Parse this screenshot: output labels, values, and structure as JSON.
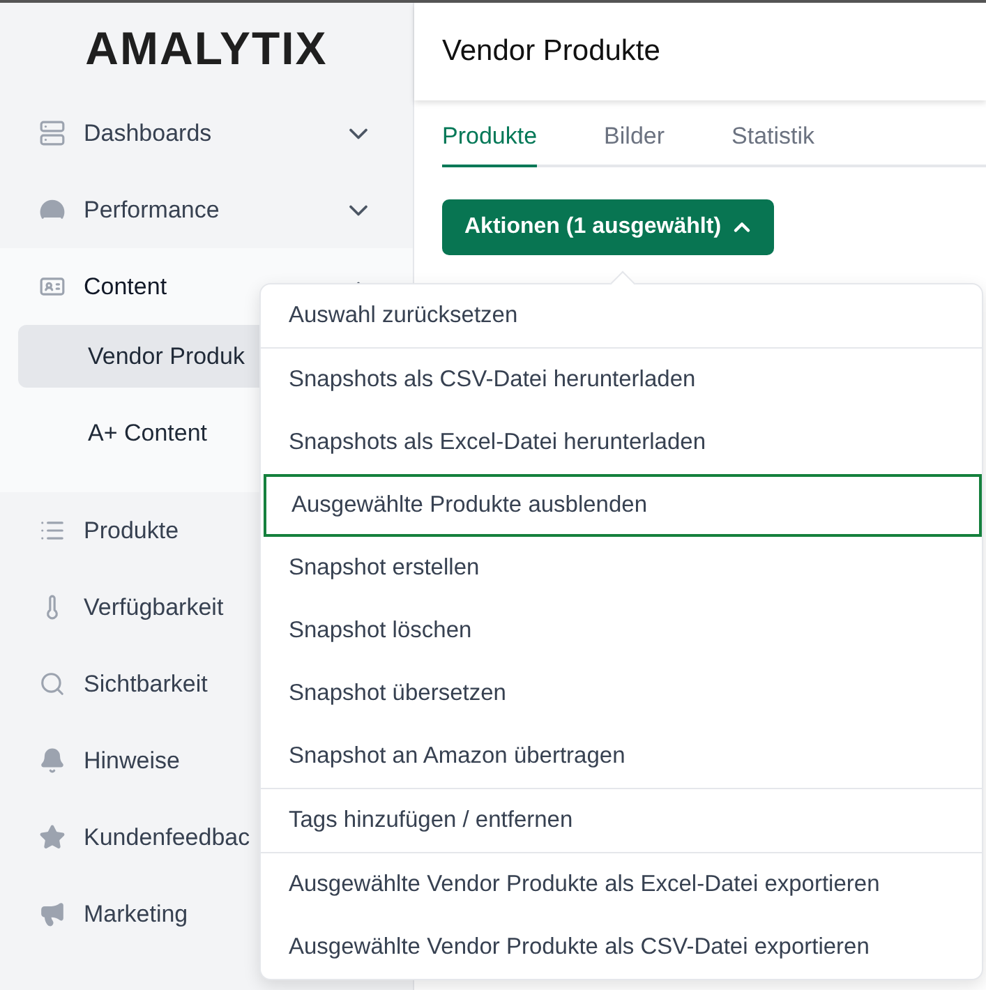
{
  "logo": "AMALYTIX",
  "sidebar": {
    "items": [
      {
        "label": "Dashboards",
        "expanded": false
      },
      {
        "label": "Performance",
        "expanded": false
      },
      {
        "label": "Content",
        "expanded": true,
        "children": [
          {
            "label": "Vendor Produk",
            "selected": true
          },
          {
            "label": "A+ Content",
            "selected": false
          }
        ]
      },
      {
        "label": "Produkte"
      },
      {
        "label": "Verfügbarkeit"
      },
      {
        "label": "Sichtbarkeit"
      },
      {
        "label": "Hinweise"
      },
      {
        "label": "Kundenfeedbac"
      },
      {
        "label": "Marketing"
      }
    ]
  },
  "header": {
    "title": "Vendor Produkte"
  },
  "tabs": [
    {
      "label": "Produkte",
      "selected": true
    },
    {
      "label": "Bilder",
      "selected": false
    },
    {
      "label": "Statistik",
      "selected": false
    }
  ],
  "actions_button": {
    "label": "Aktionen (1 ausgewählt)",
    "expanded": true
  },
  "menu": {
    "groups": [
      [
        {
          "label": "Auswahl zurücksetzen",
          "selected": false
        }
      ],
      [
        {
          "label": "Snapshots als CSV-Datei herunterladen",
          "selected": false
        },
        {
          "label": "Snapshots als Excel-Datei herunterladen",
          "selected": false
        },
        {
          "label": "Ausgewählte Produkte ausblenden",
          "selected": true
        },
        {
          "label": "Snapshot erstellen",
          "selected": false
        },
        {
          "label": "Snapshot löschen",
          "selected": false
        },
        {
          "label": "Snapshot übersetzen",
          "selected": false
        },
        {
          "label": "Snapshot an Amazon übertragen",
          "selected": false
        }
      ],
      [
        {
          "label": "Tags hinzufügen / entfernen",
          "selected": false
        }
      ],
      [
        {
          "label": "Ausgewählte Vendor Produkte als Excel-Datei exportieren",
          "selected": false
        },
        {
          "label": "Ausgewählte Vendor Produkte als CSV-Datei exportieren",
          "selected": false
        }
      ]
    ]
  }
}
